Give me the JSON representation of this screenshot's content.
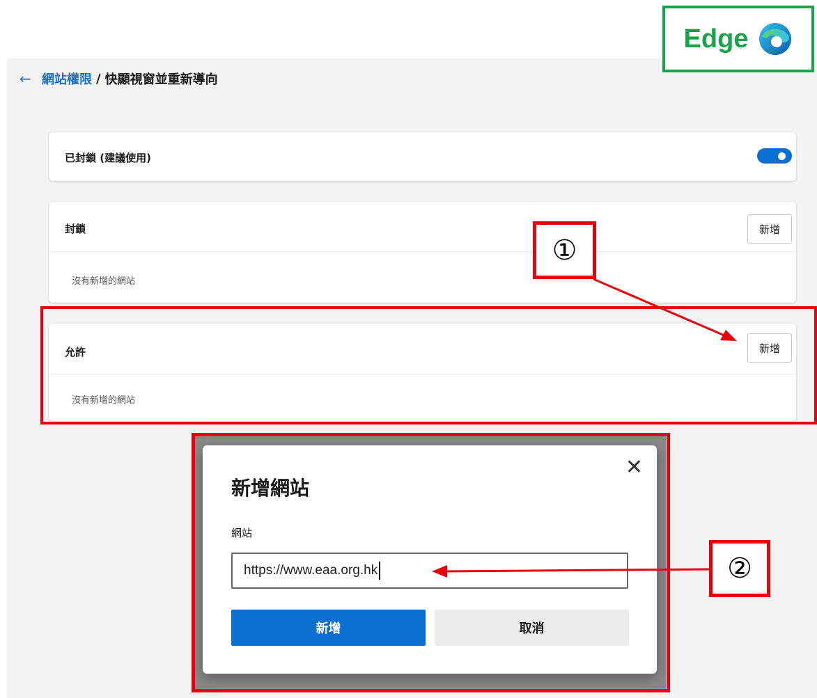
{
  "header": {
    "back_icon": "←",
    "breadcrumb_link": "網站權限",
    "breadcrumb_sep": "/",
    "breadcrumb_current": "快顯視窗並重新導向"
  },
  "blocked_setting": {
    "label": "已封鎖 (建議使用)",
    "toggle_on": true
  },
  "block_section": {
    "title": "封鎖",
    "add_label": "新增",
    "empty_text": "沒有新增的網站"
  },
  "allow_section": {
    "title": "允許",
    "add_label": "新增",
    "empty_text": "沒有新增的網站"
  },
  "dialog": {
    "title": "新增網站",
    "close_icon": "✕",
    "field_label": "網站",
    "field_value": "https://www.eaa.org.hk",
    "add_button": "新增",
    "cancel_button": "取消"
  },
  "annotations": {
    "badge_text": "Edge",
    "step1": "①",
    "step2": "②"
  },
  "colors": {
    "accent": "#0a6fd0",
    "annotation_red": "#e8000b",
    "badge_green": "#1aa34a"
  }
}
